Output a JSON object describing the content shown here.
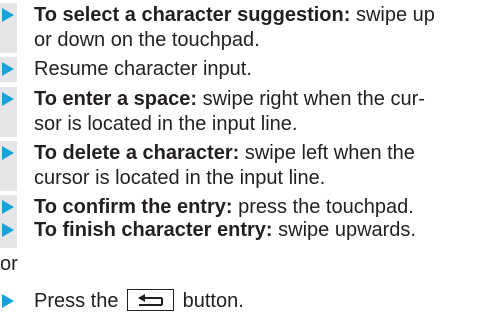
{
  "steps": [
    {
      "bold": "To select a character suggestion:",
      "line1": " swipe up",
      "line2": "or down on the touchpad."
    },
    {
      "plain": "Resume character input."
    },
    {
      "bold": "To enter a space:",
      "line1": " swipe right when the cur-",
      "line2": "sor is located in the input line."
    },
    {
      "bold": "To delete a character:",
      "line1": " swipe left when the",
      "line2": "cursor is located in the input line."
    },
    {
      "bold": "To confirm the entry:",
      "line1": " press the touchpad."
    },
    {
      "bold": "To finish character entry:",
      "line1": " swipe upwards."
    }
  ],
  "or_label": "or",
  "final_step": {
    "before": "Press the",
    "button_icon": "back-icon",
    "after": "button."
  },
  "colors": {
    "arrow": "#12a5dc",
    "bar": "#e4e5e6",
    "text": "#231f20"
  }
}
